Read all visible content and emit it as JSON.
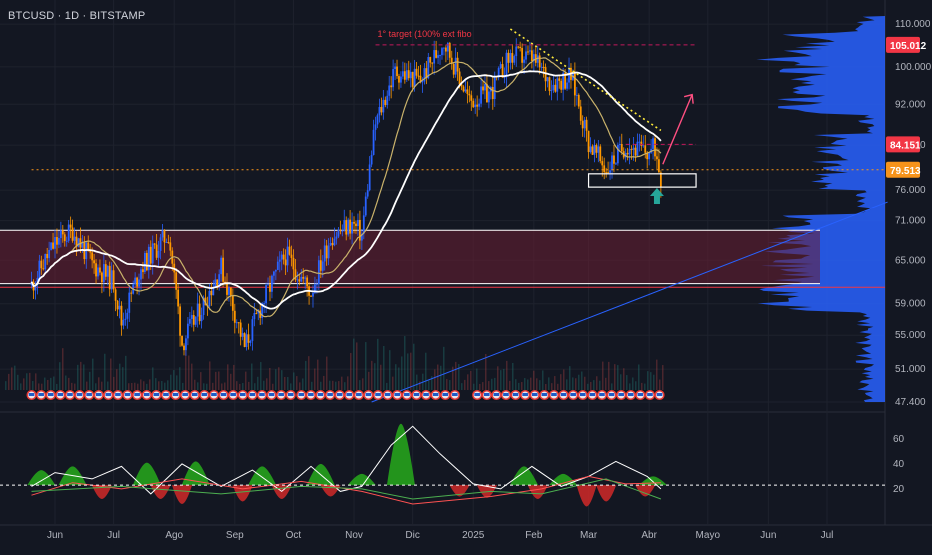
{
  "header": {
    "symbol_line": "BTCUSD · 1D · BITSTAMP"
  },
  "chart_data": [
    {
      "type": "candlestick",
      "title": "BTCUSD · 1D · BITSTAMP",
      "x_ticks": [
        "Jun",
        "Jul",
        "Ago",
        "Sep",
        "Oct",
        "Nov",
        "Dic",
        "2025",
        "Feb",
        "Mar",
        "Abr",
        "Mayo",
        "Jun",
        "Jul"
      ],
      "y_ticks": [
        "110.000",
        "100.000",
        "92.000",
        "84.000",
        "76.000",
        "71.000",
        "65.000",
        "59.000",
        "55.000",
        "51.000",
        "47.400"
      ],
      "y_scale": "log",
      "ylim": [
        47400,
        112000
      ],
      "grid": true,
      "price_labels": [
        {
          "text": "105.012",
          "value": 105012,
          "color": "#f23645"
        },
        {
          "text": "84.151",
          "value": 84151,
          "color": "#f23645"
        },
        {
          "text": "79.513",
          "value": 79513,
          "color": "#f7931a"
        }
      ],
      "price_series": {
        "dates": [
          "2024-05-20",
          "2024-06-01",
          "2024-06-10",
          "2024-06-20",
          "2024-07-01",
          "2024-07-05",
          "2024-07-15",
          "2024-07-29",
          "2024-08-05",
          "2024-08-15",
          "2024-08-25",
          "2024-09-06",
          "2024-09-15",
          "2024-09-27",
          "2024-10-10",
          "2024-10-20",
          "2024-10-31",
          "2024-11-05",
          "2024-11-12",
          "2024-11-22",
          "2024-12-05",
          "2024-12-17",
          "2024-12-30",
          "2025-01-10",
          "2025-01-20",
          "2025-01-31",
          "2025-02-10",
          "2025-02-20",
          "2025-03-01",
          "2025-03-10",
          "2025-03-20",
          "2025-03-31",
          "2025-04-04",
          "2025-04-07"
        ],
        "close": [
          61500,
          67500,
          69500,
          64500,
          62000,
          56500,
          64000,
          69000,
          54000,
          58500,
          64000,
          53500,
          59000,
          65800,
          60500,
          68500,
          70500,
          68800,
          88000,
          99000,
          97000,
          106000,
          92500,
          94500,
          102500,
          102000,
          96500,
          98000,
          84500,
          79500,
          84200,
          82500,
          83500,
          78500
        ],
        "color_up": "#2962ff",
        "color_down": "#ff9800"
      },
      "moving_averages": [
        {
          "color": "#c9b26b"
        },
        {
          "color": "#ffffff"
        }
      ],
      "annotations": [
        {
          "text": "1° target (100% ext fibo",
          "date": "2024-11-12",
          "value": 105012,
          "color": "#f23645"
        }
      ],
      "zones": [
        {
          "from": 61700,
          "to": 69500,
          "color": "#6b1f33"
        }
      ],
      "lines": [
        {
          "style": "dashed",
          "value": 105012,
          "from": "2024-11-12",
          "to": "2025-04-25",
          "color": "#c2185b"
        },
        {
          "style": "dashed",
          "value": 84151,
          "from": "2025-03-20",
          "to": "2025-04-25",
          "color": "#c2185b"
        },
        {
          "style": "dotted",
          "value": 79513,
          "from": "2024-05-20",
          "to": "2025-08-01",
          "color": "#f7931a"
        },
        {
          "style": "dotted",
          "from_point": [
            "2025-01-20",
            108800
          ],
          "to_point": [
            "2025-04-07",
            86800
          ],
          "color": "#ffeb3b"
        },
        {
          "style": "solid",
          "from_point": [
            "2024-11-10",
            47400
          ],
          "to_point": [
            "2025-08-01",
            74000
          ],
          "color": "#2962ff"
        }
      ],
      "support_box": {
        "from_date": "2025-03-01",
        "to_date": "2025-04-25",
        "from_value": 76500,
        "to_value": 78800,
        "color": "#ffffff"
      },
      "forecast_arrow": {
        "from_point": [
          "2025-04-08",
          80500
        ],
        "mid_point": [
          "2025-04-15",
          84000
        ],
        "to_point": [
          "2025-04-23",
          94000
        ],
        "color": "#ff4f81"
      },
      "marker_arrow": {
        "date": "2025-04-05",
        "value": 74000,
        "color": "#26a69a"
      },
      "event_strip": {
        "value": 47600,
        "groups": [
          [
            "2024-05-20",
            "2024-09-30"
          ],
          [
            "2024-10-05",
            "2024-12-25"
          ],
          [
            "2025-01-03",
            "2025-04-08"
          ]
        ]
      },
      "volume_profile": {
        "color": "#2962ff"
      }
    },
    {
      "type": "line",
      "title": "",
      "y_ticks": [
        "60",
        "40",
        "20"
      ],
      "ylim": [
        0,
        75
      ],
      "reference_line": {
        "value": 23,
        "style": "dashed",
        "color": "#ffffff"
      },
      "series": [
        {
          "color": "#ffffff",
          "dates": [
            "2024-05-20",
            "2024-06-01",
            "2024-06-20",
            "2024-07-05",
            "2024-07-20",
            "2024-08-05",
            "2024-08-25",
            "2024-09-10",
            "2024-09-25",
            "2024-10-10",
            "2024-10-25",
            "2024-11-05",
            "2024-11-20",
            "2024-12-01",
            "2024-12-15",
            "2025-01-01",
            "2025-01-15",
            "2025-01-31",
            "2025-02-15",
            "2025-03-01",
            "2025-03-15",
            "2025-03-31",
            "2025-04-07"
          ],
          "values": [
            22,
            33,
            28,
            38,
            16,
            40,
            22,
            35,
            18,
            38,
            18,
            22,
            55,
            70,
            48,
            24,
            20,
            38,
            22,
            30,
            42,
            30,
            20
          ]
        },
        {
          "color": "#ff5252",
          "dates": [
            "2024-05-20",
            "2024-06-10",
            "2024-07-05",
            "2024-08-05",
            "2024-09-05",
            "2024-10-05",
            "2024-11-05",
            "2024-12-01",
            "2025-01-10",
            "2025-02-05",
            "2025-03-01",
            "2025-03-20",
            "2025-04-07"
          ],
          "values": [
            15,
            25,
            20,
            28,
            20,
            26,
            18,
            8,
            14,
            20,
            30,
            24,
            25
          ]
        },
        {
          "color": "#4caf50",
          "dates": [
            "2024-05-20",
            "2024-07-05",
            "2024-08-25",
            "2024-10-05",
            "2024-11-05",
            "2024-12-01",
            "2025-01-10",
            "2025-02-05",
            "2025-03-10",
            "2025-04-07"
          ],
          "values": [
            18,
            22,
            16,
            22,
            20,
            12,
            18,
            16,
            28,
            12
          ]
        }
      ],
      "peaks_green": [
        [
          "2024-05-25",
          35
        ],
        [
          "2024-06-10",
          38
        ],
        [
          "2024-07-18",
          41
        ],
        [
          "2024-08-12",
          42
        ],
        [
          "2024-09-15",
          38
        ],
        [
          "2024-10-15",
          40
        ],
        [
          "2024-11-05",
          32
        ],
        [
          "2024-11-25",
          72
        ],
        [
          "2025-01-27",
          38
        ],
        [
          "2025-02-16",
          32
        ],
        [
          "2025-04-03",
          30
        ]
      ],
      "troughs_red": [
        [
          "2024-06-25",
          12
        ],
        [
          "2024-07-25",
          12
        ],
        [
          "2024-08-05",
          8
        ],
        [
          "2024-09-05",
          10
        ],
        [
          "2024-09-25",
          12
        ],
        [
          "2024-10-20",
          14
        ],
        [
          "2024-12-25",
          14
        ],
        [
          "2025-01-08",
          13
        ],
        [
          "2025-02-03",
          12
        ],
        [
          "2025-02-28",
          6
        ],
        [
          "2025-03-10",
          10
        ],
        [
          "2025-03-30",
          14
        ]
      ]
    }
  ]
}
